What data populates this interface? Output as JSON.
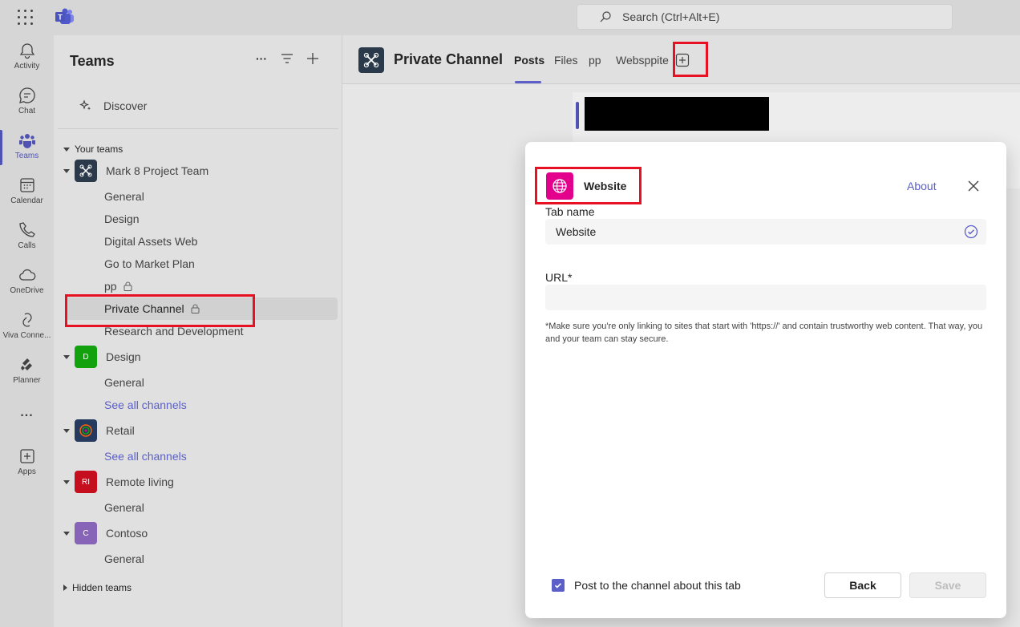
{
  "topbar": {
    "search_placeholder": "Search (Ctrl+Alt+E)"
  },
  "rail": {
    "items": [
      {
        "label": "Activity",
        "icon": "bell-icon"
      },
      {
        "label": "Chat",
        "icon": "chat-icon"
      },
      {
        "label": "Teams",
        "icon": "teams-icon",
        "active": true
      },
      {
        "label": "Calendar",
        "icon": "calendar-icon"
      },
      {
        "label": "Calls",
        "icon": "phone-icon"
      },
      {
        "label": "OneDrive",
        "icon": "cloud-icon"
      },
      {
        "label": "Viva Conne...",
        "icon": "viva-icon"
      },
      {
        "label": "Planner",
        "icon": "planner-icon"
      },
      {
        "label": "...",
        "icon": "more-icon"
      },
      {
        "label": "Apps",
        "icon": "apps-icon"
      }
    ]
  },
  "teams_pane": {
    "title": "Teams",
    "discover": "Discover",
    "your_teams": "Your teams",
    "hidden_teams": "Hidden teams",
    "teams": [
      {
        "name": "Mark 8 Project Team",
        "channels": [
          "General",
          "Design",
          "Digital Assets Web",
          "Go to Market Plan",
          "pp",
          "Private Channel",
          "Research and Development"
        ]
      },
      {
        "name": "Design",
        "initials": "D",
        "channels": [
          "General"
        ],
        "see_all": "See all channels"
      },
      {
        "name": "Retail",
        "channels": [],
        "see_all": "See all channels"
      },
      {
        "name": "Remote living",
        "initials": "RI",
        "channels": [
          "General"
        ]
      },
      {
        "name": "Contoso",
        "initials": "C",
        "channels": [
          "General"
        ]
      }
    ]
  },
  "channel_header": {
    "title": "Private Channel",
    "tabs": [
      "Posts",
      "Files",
      "pp",
      "Websppite"
    ]
  },
  "dialog": {
    "app_name": "Website",
    "about": "About",
    "tab_name_label": "Tab name",
    "tab_name_value": "Website",
    "url_label": "URL*",
    "url_value": "",
    "note": "*Make sure you're only linking to sites that start with 'https://' and contain trustworthy web content. That way, you and your team can stay secure.",
    "post_label": "Post to the channel about this tab",
    "back": "Back",
    "save": "Save"
  },
  "colors": {
    "accent": "#5b5fc7",
    "highlight": "#e81123",
    "website_app": "#e3008c"
  }
}
